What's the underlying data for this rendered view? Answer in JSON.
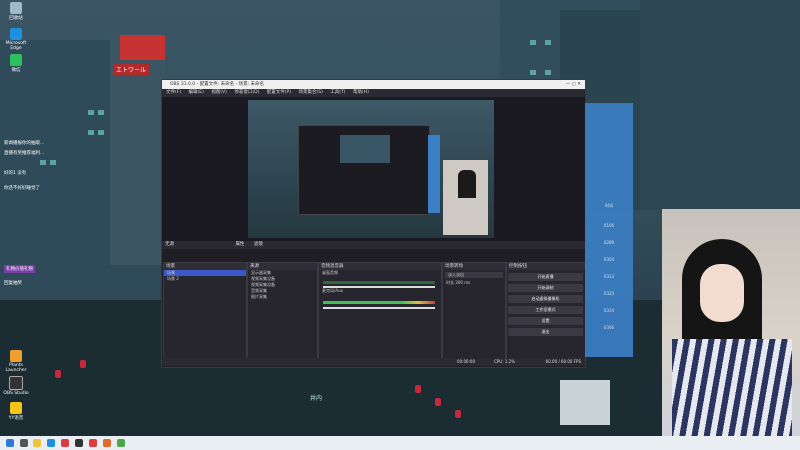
{
  "desktop": {
    "icons": [
      {
        "label": "回收站",
        "color": "#9fb8d0"
      },
      {
        "label": "Microsoft Edge",
        "color": "#1f8fe0"
      },
      {
        "label": "微信",
        "color": "#2bc15b"
      },
      {
        "label": "Plants Launcher",
        "color": "#f0a030"
      },
      {
        "label": "OBS Studio",
        "color": "#333"
      },
      {
        "label": "YY语音",
        "color": "#f5c518"
      }
    ],
    "sign_text": "エトワール",
    "street_sign": "井内"
  },
  "chat": {
    "lines": [
      "新闻播报你的抽取...",
      "直播有奖推荐福利...",
      "好的1 没有",
      "你还不好好睡觉了",
      "礼物价值礼物",
      "回复抽奖"
    ]
  },
  "obs": {
    "title": "OBS 31.0.0 - 配置文件: 未命名 - 场景: 未命名",
    "menu": [
      "文件(F)",
      "编辑(E)",
      "视图(V)",
      "停靠窗口(D)",
      "配置文件(P)",
      "场景集合(S)",
      "工具(T)",
      "帮助(H)"
    ],
    "preview_caption": "无源",
    "toolbar": {
      "properties": "属性",
      "filters": "滤镜"
    },
    "scenes": {
      "title": "场景",
      "items": [
        "场景",
        "场景 2"
      ]
    },
    "sources": {
      "title": "来源",
      "items": [
        "显示器采集",
        "视频采集设备",
        "视频采集设备",
        "音频采集",
        "图片采集"
      ]
    },
    "mixer": {
      "title": "音频混音器",
      "tracks": [
        "桌面音频",
        "麦克风/Aux"
      ]
    },
    "transitions": {
      "title": "场景转场",
      "type": "淡入淡出",
      "duration_label": "时长",
      "duration": "300 ms"
    },
    "controls": {
      "title": "控制按钮",
      "buttons": [
        "开始直播",
        "开始录制",
        "启动虚拟摄像机",
        "工作室模式",
        "设置",
        "退出"
      ]
    },
    "status": {
      "cpu": "CPU: 1.2%",
      "fps": "60.00 / 60.00 FPS",
      "time": "00:00:00"
    }
  },
  "side_panel": {
    "items": [
      "0106",
      "0289",
      "0304",
      "0313",
      "0325",
      "0334",
      "0346",
      "0407"
    ],
    "heading": "时间"
  },
  "colors": {
    "accent": "#3b7fc4",
    "obs_bg": "#1f1e25",
    "selected": "#3a58c8"
  }
}
